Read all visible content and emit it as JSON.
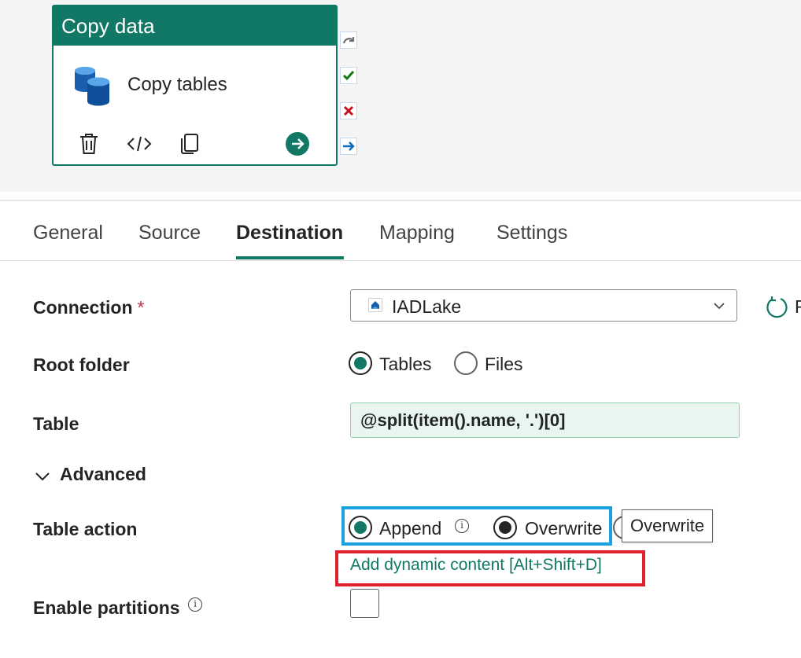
{
  "activity": {
    "type_label": "Copy data",
    "name": "Copy tables"
  },
  "tabs": [
    {
      "label": "General"
    },
    {
      "label": "Source"
    },
    {
      "label": "Destination"
    },
    {
      "label": "Mapping"
    },
    {
      "label": "Settings"
    }
  ],
  "active_tab": "Destination",
  "form": {
    "connection": {
      "label": "Connection",
      "required_mark": "*",
      "value": "IADLake",
      "refresh_label": "R"
    },
    "root_folder": {
      "label": "Root folder",
      "options": [
        "Tables",
        "Files"
      ],
      "selected": "Tables"
    },
    "table": {
      "label": "Table",
      "value": "@split(item().name, '.')[0]"
    },
    "advanced": {
      "label": "Advanced"
    },
    "table_action": {
      "label": "Table action",
      "options": [
        "Append",
        "Overwrite"
      ],
      "selected": "Append",
      "tooltip": "Overwrite"
    },
    "dynamic_content_link": "Add dynamic content [Alt+Shift+D]",
    "enable_partitions": {
      "label": "Enable partitions",
      "checked": false
    }
  },
  "colors": {
    "accent": "#117865",
    "highlight_blue": "#1ba0e0",
    "highlight_red": "#e0202e",
    "table_input_bg": "#e8f6ef"
  },
  "icons": {
    "card": [
      "database-icon",
      "delete-icon",
      "code-icon",
      "copy-icon",
      "go-arrow-icon"
    ],
    "side": [
      "skip-icon",
      "success-icon",
      "failure-icon",
      "completion-icon"
    ]
  }
}
